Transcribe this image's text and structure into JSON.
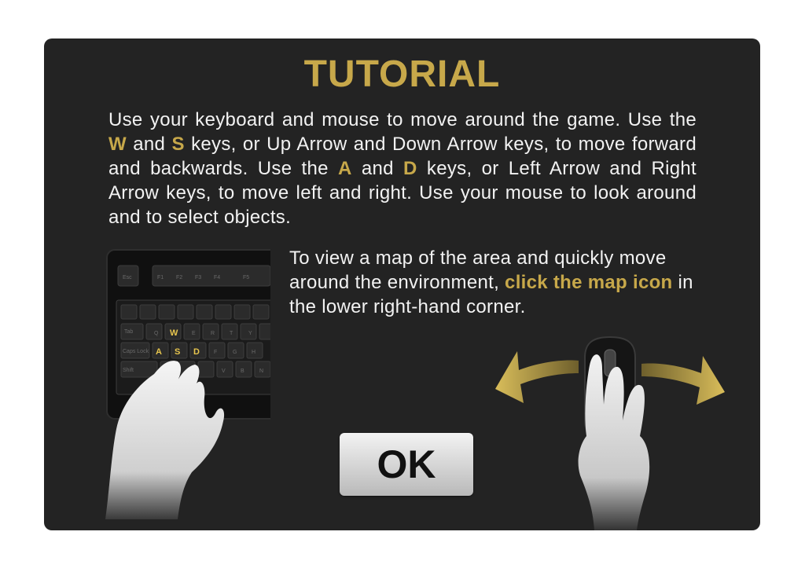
{
  "title": "TUTORIAL",
  "intro": {
    "p1": "Use your keyboard and mouse to move around the game. Use the ",
    "key_w": "W",
    "p2": " and ",
    "key_s": "S",
    "p3": " keys, or Up Arrow and Down Arrow keys, to move forward and backwards. Use the ",
    "key_a": "A",
    "p4": " and ",
    "key_d": "D",
    "p5": " keys, or Left Arrow and Right Arrow keys, to move left and right. Use your mouse to look around and to select objects."
  },
  "map_info": {
    "p1": "To view a map of the area and quickly move around the environment, ",
    "highlight": "click the map icon",
    "p2": " in the lower right-hand corner."
  },
  "keyboard_keys": {
    "esc": "Esc",
    "f1": "F1",
    "f2": "F2",
    "f3": "F3",
    "f4": "F4",
    "f5": "F5",
    "tab": "Tab",
    "caps": "Caps Lock",
    "shift": "Shift",
    "q": "Q",
    "w": "W",
    "e": "E",
    "r": "R",
    "t": "T",
    "y": "Y",
    "a": "A",
    "s": "S",
    "d": "D",
    "f": "F",
    "g": "G",
    "h": "H",
    "v": "V",
    "b": "B",
    "n": "N"
  },
  "ok_label": "OK",
  "colors": {
    "accent": "#c7a84a",
    "panel": "#232323",
    "text": "#f2f2f2"
  }
}
